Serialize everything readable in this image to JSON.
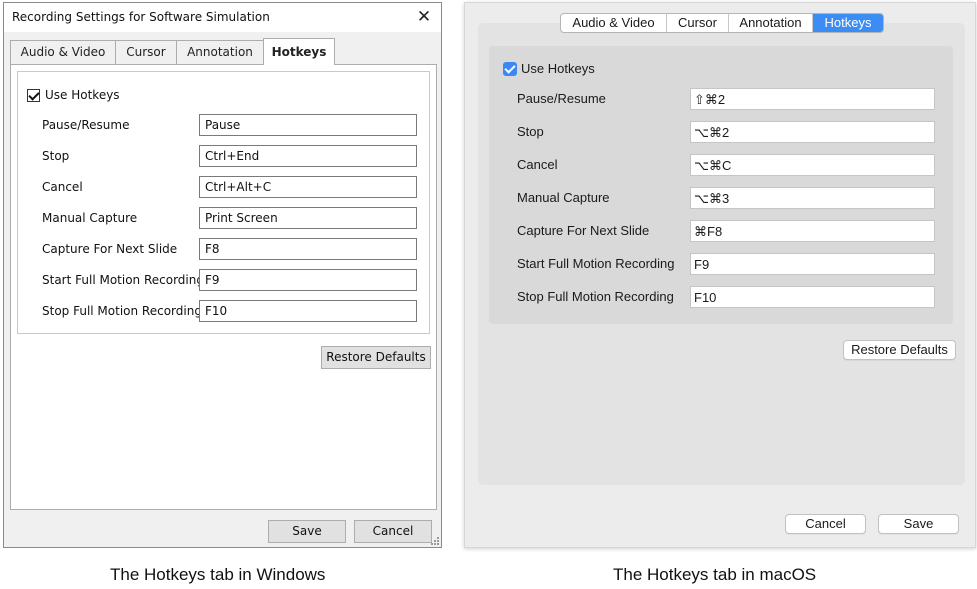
{
  "windows": {
    "title": "Recording Settings for Software Simulation",
    "close_glyph": "✕",
    "tabs": [
      {
        "label": "Audio & Video"
      },
      {
        "label": "Cursor"
      },
      {
        "label": "Annotation"
      },
      {
        "label": "Hotkeys",
        "active": true
      }
    ],
    "use_hotkeys": {
      "label": "Use Hotkeys",
      "checked": true
    },
    "hotkeys": [
      {
        "label": "Pause/Resume",
        "value": "Pause"
      },
      {
        "label": "Stop",
        "value": "Ctrl+End"
      },
      {
        "label": "Cancel",
        "value": "Ctrl+Alt+C"
      },
      {
        "label": "Manual Capture",
        "value": "Print Screen"
      },
      {
        "label": "Capture For Next Slide",
        "value": "F8"
      },
      {
        "label": "Start Full Motion Recording",
        "value": "F9"
      },
      {
        "label": "Stop Full Motion Recording",
        "value": "F10"
      }
    ],
    "restore_defaults_label": "Restore Defaults",
    "save_label": "Save",
    "cancel_label": "Cancel"
  },
  "mac": {
    "tabs": [
      {
        "label": "Audio & Video"
      },
      {
        "label": "Cursor"
      },
      {
        "label": "Annotation"
      },
      {
        "label": "Hotkeys",
        "active": true
      }
    ],
    "use_hotkeys": {
      "label": "Use Hotkeys",
      "checked": true
    },
    "hotkeys": [
      {
        "label": "Pause/Resume",
        "value": "⇧⌘2"
      },
      {
        "label": "Stop",
        "value": "⌥⌘2"
      },
      {
        "label": "Cancel",
        "value": "⌥⌘C"
      },
      {
        "label": "Manual Capture",
        "value": "⌥⌘3"
      },
      {
        "label": "Capture For Next Slide",
        "value": "⌘F8"
      },
      {
        "label": "Start Full Motion Recording",
        "value": "F9"
      },
      {
        "label": "Stop Full Motion Recording",
        "value": "F10"
      }
    ],
    "restore_defaults_label": "Restore Defaults",
    "cancel_label": "Cancel",
    "save_label": "Save",
    "accent_color": "#3c8cf5"
  },
  "captions": {
    "windows": "The Hotkeys tab in Windows",
    "mac": "The Hotkeys tab in macOS"
  }
}
